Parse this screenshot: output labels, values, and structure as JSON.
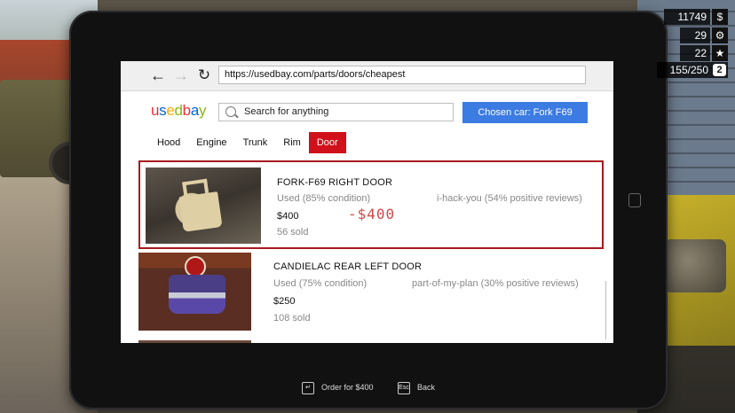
{
  "browser": {
    "url": "https://usedbay.com/parts/doors/cheapest",
    "back_glyph": "←",
    "forward_glyph": "→",
    "reload_glyph": "↻"
  },
  "site": {
    "logo": [
      "u",
      "s",
      "e",
      "d",
      "b",
      "a",
      "y"
    ],
    "search_placeholder": "Search for anything",
    "chosen_car": "Chosen car: Fork F69"
  },
  "tabs": [
    {
      "label": "Hood",
      "active": false
    },
    {
      "label": "Engine",
      "active": false
    },
    {
      "label": "Trunk",
      "active": false
    },
    {
      "label": "Rim",
      "active": false
    },
    {
      "label": "Door",
      "active": true
    }
  ],
  "listings": [
    {
      "title": "FORK-F69 RIGHT DOOR",
      "condition": "Used (85% condition)",
      "seller": "i-hack-you (54% positive reviews)",
      "price": "$400",
      "sold": "56 sold",
      "price_change": "-$400",
      "selected": true
    },
    {
      "title": "CANDIELAC REAR LEFT DOOR",
      "condition": "Used (75% condition)",
      "seller": "part-of-my-plan (30% positive reviews)",
      "price": "$250",
      "sold": "108 sold",
      "selected": false
    }
  ],
  "hud": {
    "money": "11749",
    "money_icon": "$",
    "tools": "29",
    "tools_icon": "⚙",
    "stars": "22",
    "stars_icon": "★",
    "inventory": "155/250",
    "inventory_icon": "2"
  },
  "hints": {
    "order_key": "↵",
    "order_label": "Order for $400",
    "back_key": "Esc",
    "back_label": "Back"
  },
  "colors": {
    "accent_blue": "#3c7be2",
    "active_tab_red": "#d0101a",
    "selected_border": "#a8181e",
    "price_change_red": "#d04848"
  }
}
